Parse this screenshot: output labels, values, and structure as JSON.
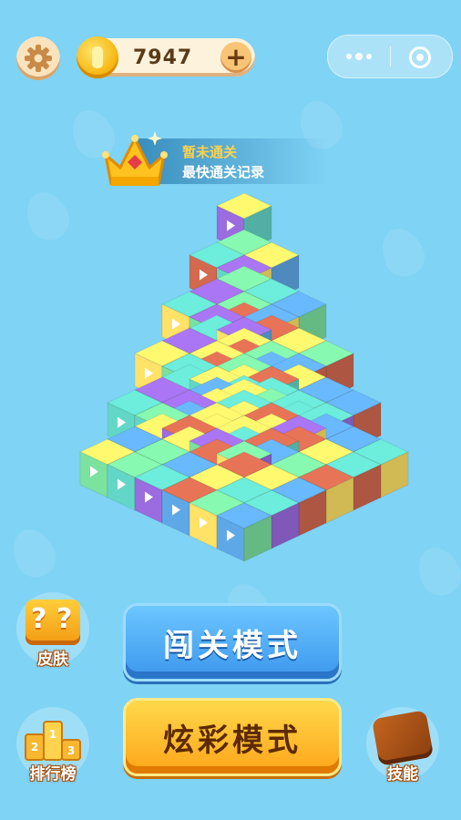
{
  "top_bar": {
    "settings_icon": "gear-icon",
    "coins": "7947",
    "plus_label": "+",
    "more_icon": "more-dots-icon",
    "close_icon": "target-circle-icon"
  },
  "record": {
    "status": "暂未通关",
    "label": "最快通关记录",
    "icon": "crown-icon"
  },
  "modes": {
    "level_mode": "闯关模式",
    "color_mode": "炫彩模式"
  },
  "side_buttons": {
    "skin": "皮肤",
    "rank": "排行榜",
    "skill": "技能"
  },
  "colors": {
    "background": "#7fd3f5",
    "cube_colors": [
      "#63d7c7",
      "#7be2a0",
      "#ffe266",
      "#9b6be0",
      "#5fa8e8",
      "#d3694f"
    ]
  }
}
